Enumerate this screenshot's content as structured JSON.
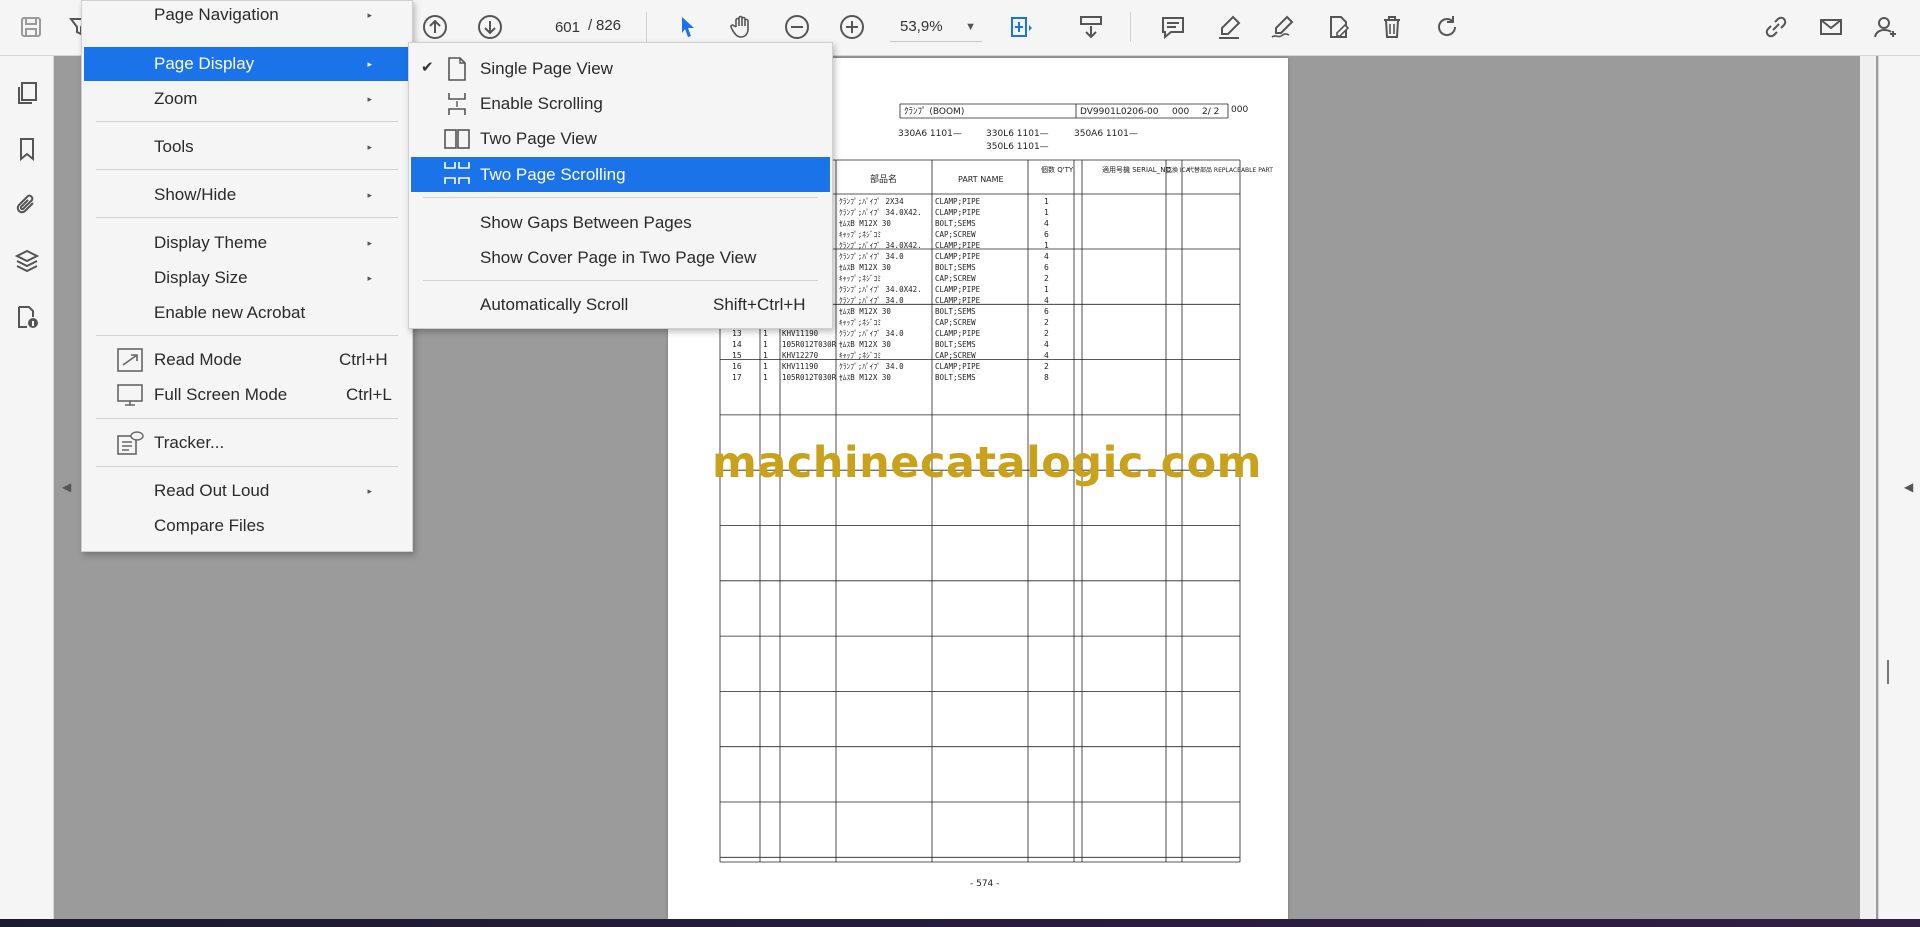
{
  "toolbar": {
    "page_current": "601",
    "page_separator": "/",
    "page_total": "826",
    "zoom": "53,9%"
  },
  "main_menu": {
    "items": [
      {
        "label": "Page Navigation",
        "arrow": "▸"
      },
      {
        "label": "Page Display",
        "arrow": "▸"
      },
      {
        "label": "Zoom",
        "arrow": "▸"
      },
      {
        "label": "Tools",
        "arrow": "▸"
      },
      {
        "label": "Show/Hide",
        "arrow": "▸"
      },
      {
        "label": "Display Theme",
        "arrow": "▸"
      },
      {
        "label": "Display Size",
        "arrow": "▸"
      },
      {
        "label": "Enable new Acrobat"
      },
      {
        "label": "Read Mode",
        "shortcut": "Ctrl+H"
      },
      {
        "label": "Full Screen Mode",
        "shortcut": "Ctrl+L"
      },
      {
        "label": "Tracker..."
      },
      {
        "label": "Read Out Loud",
        "arrow": "▸"
      },
      {
        "label": "Compare Files"
      }
    ]
  },
  "sub_menu": {
    "items": [
      {
        "label": "Single Page View",
        "checked": "✔"
      },
      {
        "label": "Enable Scrolling"
      },
      {
        "label": "Two Page View"
      },
      {
        "label": "Two Page Scrolling"
      },
      {
        "label": "Show Gaps Between Pages"
      },
      {
        "label": "Show Cover Page in Two Page View"
      },
      {
        "label": "Automatically Scroll",
        "shortcut": "Shift+Ctrl+H"
      }
    ]
  },
  "document": {
    "header_title": "ｸﾗﾝﾌﾟ (BOOM)",
    "header_code": "DV9901L0206-00",
    "header_rev": "000",
    "header_page": "2/ 2",
    "header_extra": "000",
    "models_line1": [
      "330A6 1101—",
      "330L6 1101—",
      "350A6 1101—"
    ],
    "models_line2": "350L6 1101—",
    "columns": [
      "部品名",
      "PART NAME",
      "個数 Q'TY",
      "適用号機 SERIAL_NO.",
      "互換 ICA",
      "代替部品 REPLACEABLE PART"
    ],
    "rows": [
      {
        "jp": "ｸﾗﾝﾌﾟ;ﾊﾟｲﾌﾟ 2X34",
        "name": "CLAMP;PIPE",
        "qty": "1"
      },
      {
        "jp": "ｸﾗﾝﾌﾟ;ﾊﾟｲﾌﾟ 34.0X42.",
        "name": "CLAMP;PIPE",
        "qty": "1"
      },
      {
        "jp": "ｾﾑｽB M12X 30",
        "name": "BOLT;SEMS",
        "qty": "4"
      },
      {
        "jp": "ｷｬｯﾌﾟ;ﾈｼﾞｺﾐ",
        "name": "CAP;SCREW",
        "qty": "6"
      },
      {
        "jp": "ｸﾗﾝﾌﾟ;ﾊﾟｲﾌﾟ 34.0X42.",
        "name": "CLAMP;PIPE",
        "qty": "1"
      },
      {
        "jp": "ｸﾗﾝﾌﾟ;ﾊﾟｲﾌﾟ 34.0",
        "name": "CLAMP;PIPE",
        "qty": "4"
      },
      {
        "jp": "ｾﾑｽB M12X 30",
        "name": "BOLT;SEMS",
        "qty": "6"
      },
      {
        "jp": "ｷｬｯﾌﾟ;ﾈｼﾞｺﾐ",
        "name": "CAP;SCREW",
        "qty": "2"
      },
      {
        "jp": "ｸﾗﾝﾌﾟ;ﾊﾟｲﾌﾟ 34.0X42.",
        "name": "CLAMP;PIPE",
        "qty": "1"
      },
      {
        "jp": "ｸﾗﾝﾌﾟ;ﾊﾟｲﾌﾟ 34.0",
        "name": "CLAMP;PIPE",
        "qty": "4"
      },
      {
        "jp": "ｾﾑｽB M12X 30",
        "name": "BOLT;SEMS",
        "qty": "6"
      },
      {
        "jp": "ｷｬｯﾌﾟ;ﾈｼﾞｺﾐ",
        "name": "CAP;SCREW",
        "qty": "2"
      },
      {
        "no": "13",
        "q": "1",
        "part": "KHV11190",
        "jp": "ｸﾗﾝﾌﾟ;ﾊﾟｲﾌﾟ 34.0",
        "name": "CLAMP;PIPE",
        "qty": "2"
      },
      {
        "no": "14",
        "q": "1",
        "part": "105R012T030R",
        "jp": "ｾﾑｽB M12X 30",
        "name": "BOLT;SEMS",
        "qty": "4"
      },
      {
        "no": "15",
        "q": "1",
        "part": "KHV12270",
        "jp": "ｷｬｯﾌﾟ;ﾈｼﾞｺﾐ",
        "name": "CAP;SCREW",
        "qty": "4"
      },
      {
        "no": "16",
        "q": "1",
        "part": "KHV11190",
        "jp": "ｸﾗﾝﾌﾟ;ﾊﾟｲﾌﾟ 34.0",
        "name": "CLAMP;PIPE",
        "qty": "2"
      },
      {
        "no": "17",
        "q": "1",
        "part": "105R012T030R",
        "jp": "ｾﾑｽB M12X 30",
        "name": "BOLT;SEMS",
        "qty": "8"
      }
    ],
    "footer_page": "- 574 -",
    "watermark": "machinecatalogic.com"
  },
  "colors": {
    "menu_highlight": "#1a73e8",
    "toolbar_bg": "#f5f5f5",
    "workspace_bg": "#9b9b9b",
    "watermark": "#c9a21c",
    "accent_icon": "#1a73e8"
  },
  "icons": {
    "toolbar": [
      "save-icon",
      "filter-icon",
      "page-up-icon",
      "page-down-icon",
      "select-arrow-icon",
      "hand-icon",
      "zoom-out-icon",
      "zoom-in-icon",
      "fit-page-icon",
      "scroll-mode-icon",
      "comment-icon",
      "highlight-icon",
      "draw-icon",
      "fill-sign-icon",
      "delete-icon",
      "rotate-icon",
      "share-link-icon",
      "email-icon",
      "account-icon"
    ],
    "left_rail": [
      "pages-icon",
      "bookmark-icon",
      "attachment-icon",
      "layers-icon",
      "content-icon"
    ]
  }
}
